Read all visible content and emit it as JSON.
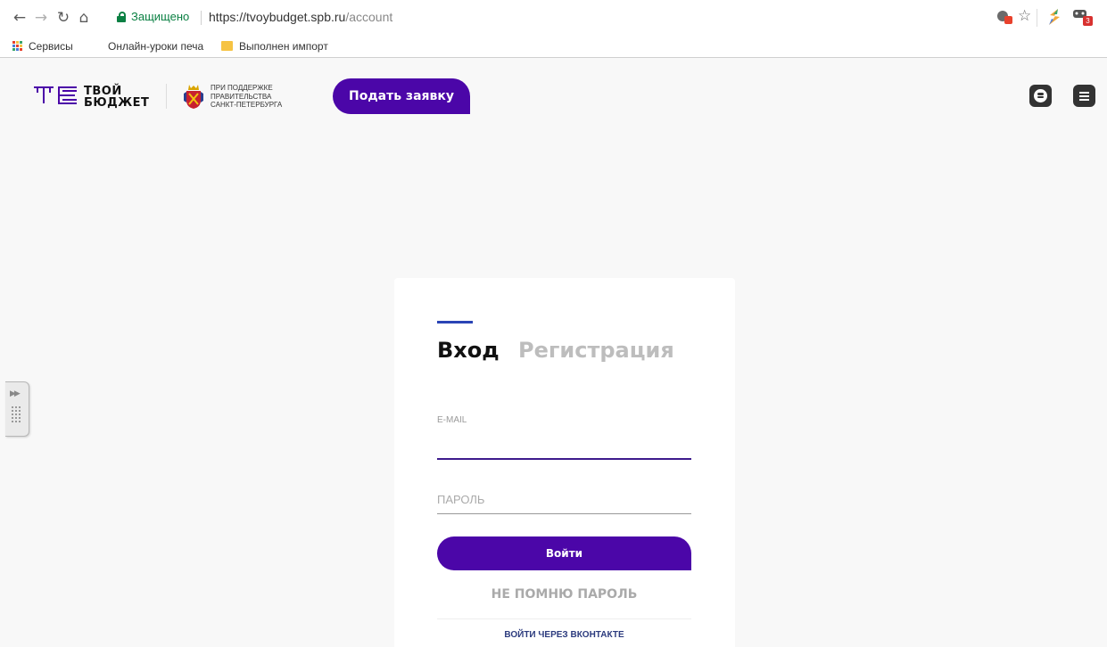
{
  "browser": {
    "secure_label": "Защищено",
    "url_host": "https://tvoybudget.spb.ru",
    "url_path": "/account",
    "extension_badge": "3",
    "bookmarks": [
      {
        "label": "Сервисы"
      },
      {
        "label": "Онлайн-уроки печа"
      },
      {
        "label": "Выполнен импорт"
      }
    ]
  },
  "header": {
    "logo_line1": "ТВОЙ",
    "logo_line2": "БЮДЖЕТ",
    "support_line1": "ПРИ ПОДДЕРЖКЕ",
    "support_line2": "ПРАВИТЕЛЬСТВА",
    "support_line3": "САНКТ-ПЕТЕРБУРГА",
    "apply_label": "Подать заявку",
    "brand_color": "#4b06a8"
  },
  "login": {
    "tab_login": "Вход",
    "tab_register": "Регистрация",
    "email_label": "E-MAIL",
    "email_value": "",
    "password_placeholder": "ПАРОЛЬ",
    "submit_label": "Войти",
    "forgot_label": "НЕ ПОМНЮ ПАРОЛЬ",
    "vk_label": "ВОЙТИ ЧЕРЕЗ ВКОНТАКТЕ"
  }
}
